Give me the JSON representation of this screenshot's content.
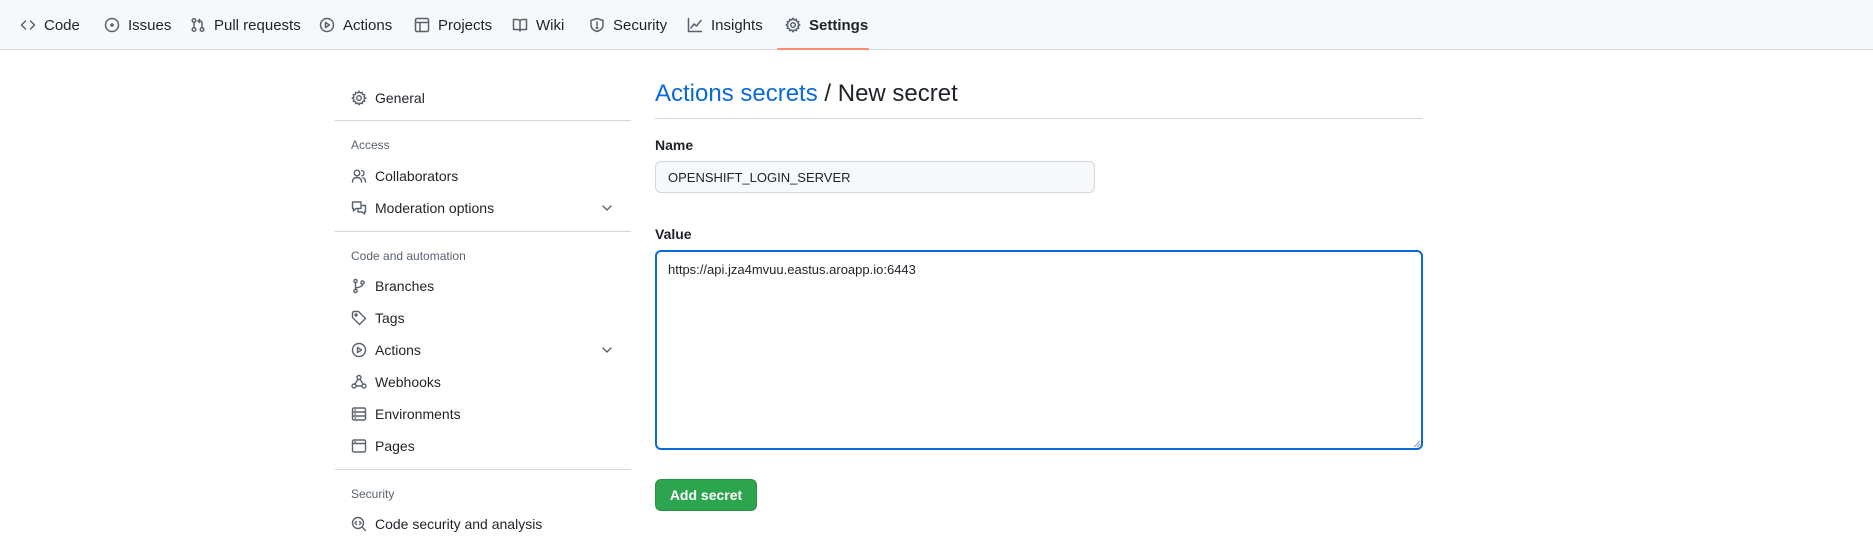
{
  "repo_nav": {
    "tabs": [
      {
        "label": "Code",
        "icon": "code-icon"
      },
      {
        "label": "Issues",
        "icon": "issue-opened-icon"
      },
      {
        "label": "Pull requests",
        "icon": "git-pull-request-icon"
      },
      {
        "label": "Actions",
        "icon": "play-icon"
      },
      {
        "label": "Projects",
        "icon": "table-icon"
      },
      {
        "label": "Wiki",
        "icon": "book-icon"
      },
      {
        "label": "Security",
        "icon": "shield-icon"
      },
      {
        "label": "Insights",
        "icon": "graph-icon"
      },
      {
        "label": "Settings",
        "icon": "gear-icon"
      }
    ],
    "selected": "Settings",
    "underline_color": "#fd8c73"
  },
  "sidebar": {
    "general": "General",
    "access_heading": "Access",
    "collaborators": "Collaborators",
    "moderation": "Moderation options",
    "code_heading": "Code and automation",
    "branches": "Branches",
    "tags": "Tags",
    "actions": "Actions",
    "webhooks": "Webhooks",
    "environments": "Environments",
    "pages": "Pages",
    "security_heading": "Security",
    "code_security": "Code security and analysis"
  },
  "page": {
    "title_link": "Actions secrets",
    "title_separator": " / ",
    "title_current": "New secret"
  },
  "form": {
    "name_label": "Name",
    "name_value": "OPENSHIFT_LOGIN_SERVER",
    "value_label": "Value",
    "value_text": "https://api.jza4mvuu.eastus.aroapp.io:6443",
    "submit_label": "Add secret"
  },
  "colors": {
    "link": "#0969da",
    "primary_button": "#2da44e",
    "focus_border": "#0969da"
  }
}
